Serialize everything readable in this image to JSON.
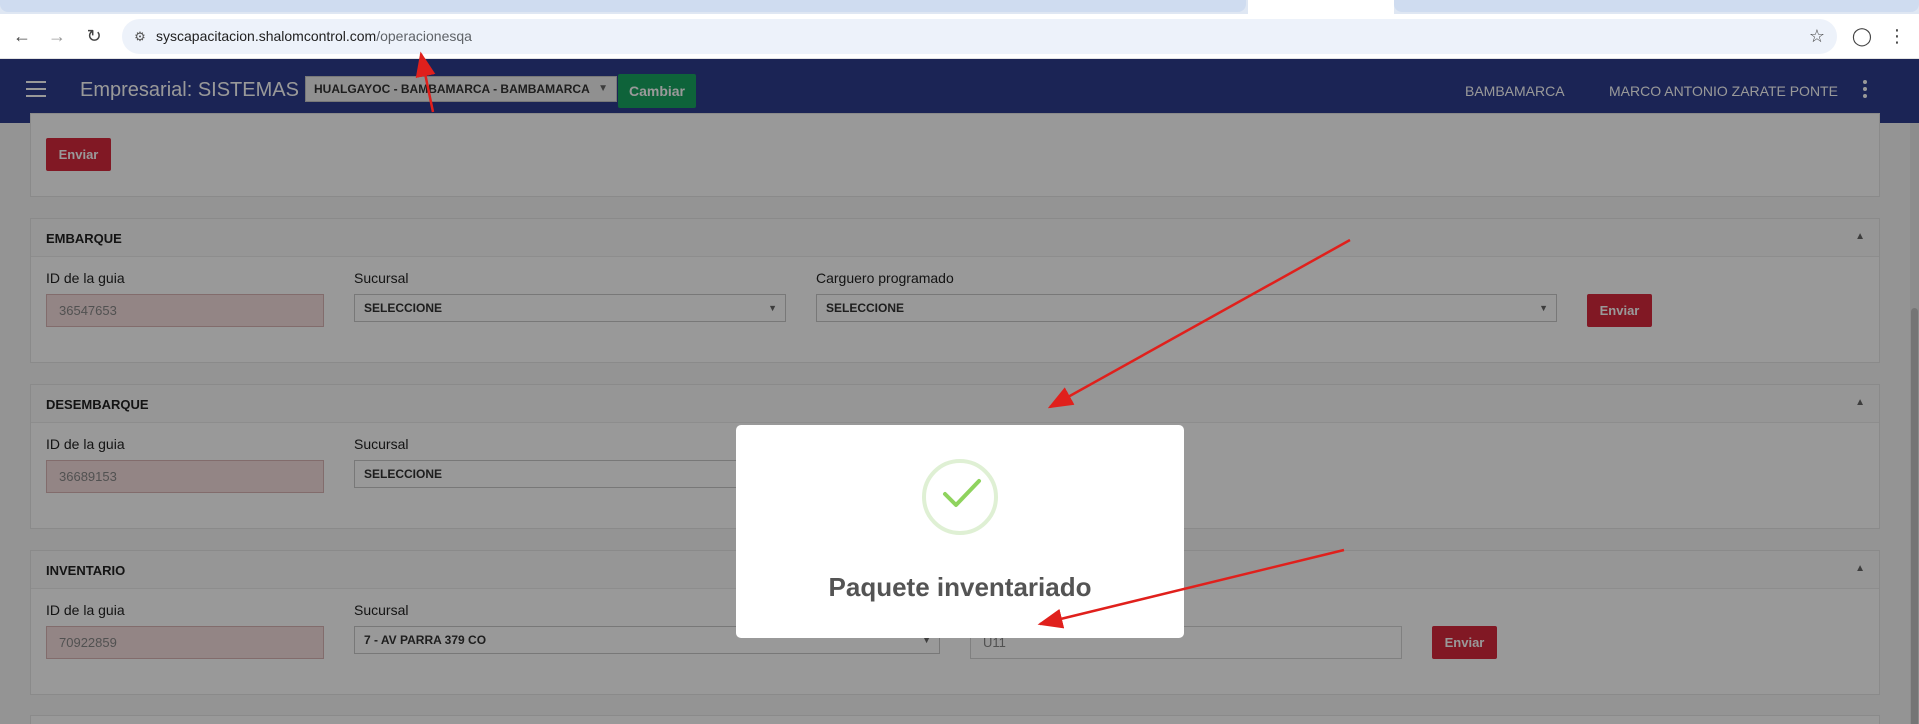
{
  "browser": {
    "url_host": "syscapacitacion.shalomcontrol.com",
    "url_path": "/operacionesqa",
    "back_icon": "arrow-left-icon",
    "forward_icon": "arrow-right-icon",
    "reload_icon": "reload-icon",
    "star_icon": "star-icon",
    "profile_icon": "profile-icon",
    "menu_icon": "kebab-icon"
  },
  "header": {
    "title": "Empresarial: SISTEMAS",
    "location_select": "HUALGAYOC - BAMBAMARCA - BAMBAMARCA",
    "change_button": "Cambiar",
    "branch": "BAMBAMARCA",
    "user": "MARCO ANTONIO ZARATE PONTE"
  },
  "top_section": {
    "send_button": "Enviar"
  },
  "embarque": {
    "title": "EMBARQUE",
    "id_label": "ID de la guia",
    "id_value": "36547653",
    "branch_label": "Sucursal",
    "branch_value": "SELECCIONE",
    "cargo_label": "Carguero programado",
    "cargo_value": "SELECCIONE",
    "send_button": "Enviar"
  },
  "desembarque": {
    "title": "DESEMBARQUE",
    "id_label": "ID de la guia",
    "id_value": "36689153",
    "branch_label": "Sucursal",
    "branch_value": "SELECCIONE"
  },
  "inventario": {
    "title": "INVENTARIO",
    "id_label": "ID de la guia",
    "id_value": "70922859",
    "branch_label": "Sucursal",
    "branch_value": "7 - AV PARRA 379 CO",
    "code_value": "U11",
    "send_button": "Enviar"
  },
  "modal": {
    "icon": "success-check-icon",
    "title": "Paquete inventariado"
  },
  "colors": {
    "appbar": "#2d3d8e",
    "accent_green": "#18a661",
    "danger_red": "#d7283c",
    "annotation_red": "#e0201c"
  }
}
